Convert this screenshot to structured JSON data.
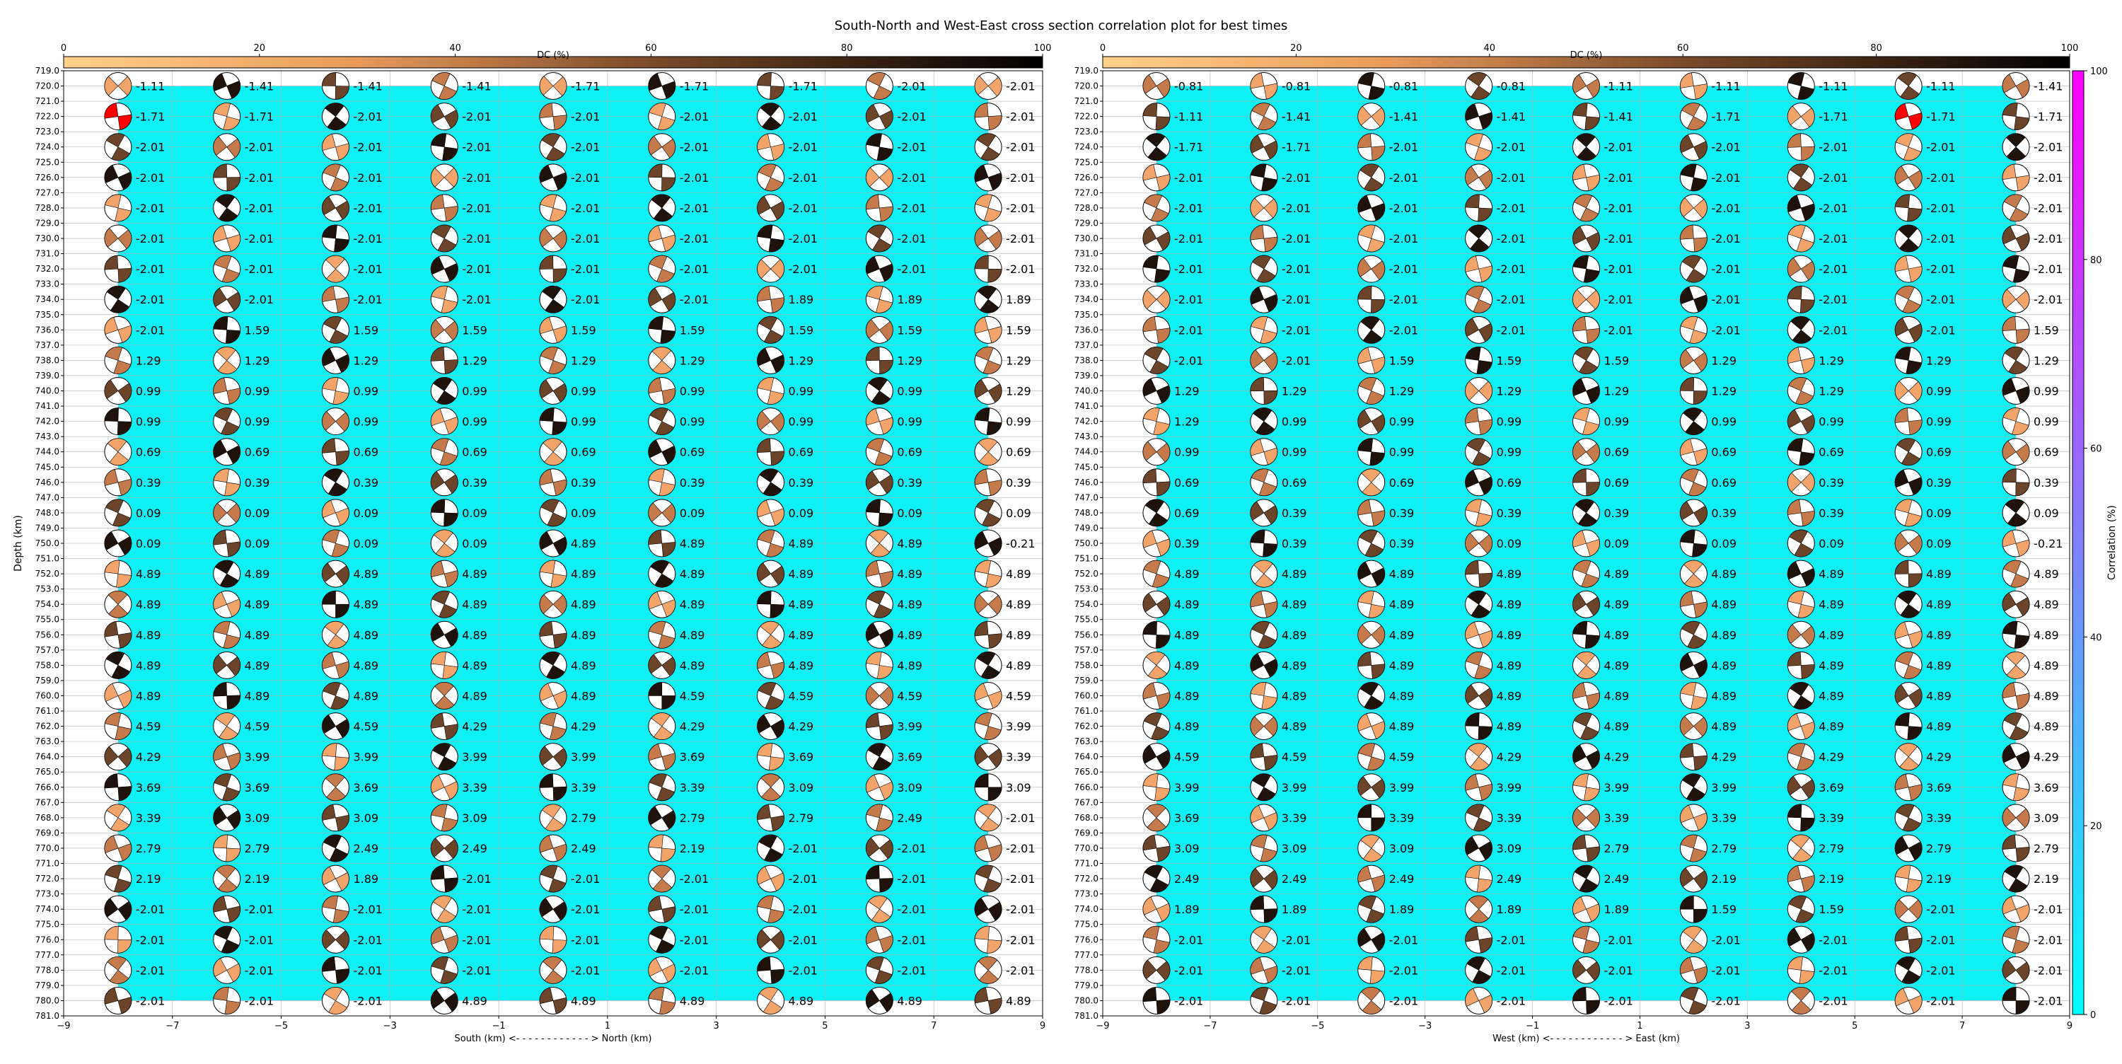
{
  "title": "South-North and West-East cross section correlation plot for best times",
  "colors": {
    "background_fill": "#0ef0f4",
    "dc_cmap": [
      "#ffffff",
      "#f5a865",
      "#c97b4a",
      "#7a4a2a",
      "#000000"
    ],
    "corr_cmap": [
      "#00ffff",
      "#8080ff",
      "#ff00ff"
    ],
    "highlight": "#ff0000",
    "grid": "#b0b0b0"
  },
  "dc_colorbar": {
    "label": "DC (%)",
    "ticks": [
      "0",
      "20",
      "40",
      "60",
      "80",
      "100"
    ]
  },
  "corr_colorbar": {
    "label": "Correlation (%)",
    "ticks": [
      "0",
      "20",
      "40",
      "60",
      "80",
      "100"
    ]
  },
  "y_label": "Depth (km)",
  "y_ticks": [
    "719.0",
    "720.0",
    "721.0",
    "722.0",
    "723.0",
    "724.0",
    "725.0",
    "726.0",
    "727.0",
    "728.0",
    "729.0",
    "730.0",
    "731.0",
    "732.0",
    "733.0",
    "734.0",
    "735.0",
    "736.0",
    "737.0",
    "738.0",
    "739.0",
    "740.0",
    "741.0",
    "742.0",
    "743.0",
    "744.0",
    "745.0",
    "746.0",
    "747.0",
    "748.0",
    "749.0",
    "750.0",
    "751.0",
    "752.0",
    "753.0",
    "754.0",
    "755.0",
    "756.0",
    "757.0",
    "758.0",
    "759.0",
    "760.0",
    "761.0",
    "762.0",
    "763.0",
    "764.0",
    "765.0",
    "766.0",
    "767.0",
    "768.0",
    "769.0",
    "770.0",
    "771.0",
    "772.0",
    "773.0",
    "774.0",
    "775.0",
    "776.0",
    "777.0",
    "778.0",
    "779.0",
    "780.0",
    "781.0"
  ],
  "chart_data": [
    {
      "type": "heatmap",
      "xlabel": "South (km) <- - - - - - - - - - - - > North (km)",
      "ylabel": "Depth (km)",
      "xlim": [
        -9,
        9
      ],
      "ylim": [
        781,
        719
      ],
      "x_ticks": [
        "−9",
        "−7",
        "−5",
        "−3",
        "−1",
        "1",
        "3",
        "5",
        "7",
        "9"
      ],
      "x": [
        -8,
        -6,
        -4,
        -2,
        0,
        2,
        4,
        6,
        8
      ],
      "depths": [
        720,
        722,
        724,
        726,
        728,
        730,
        732,
        734,
        736,
        738,
        740,
        742,
        744,
        746,
        748,
        750,
        752,
        754,
        756,
        758,
        760,
        762,
        764,
        766,
        768,
        770,
        772,
        774,
        776,
        778,
        780
      ],
      "labels": [
        [
          "-1.11",
          "-1.41",
          "-1.41",
          "-1.41",
          "-1.71",
          "-1.71",
          "-1.71",
          "-2.01",
          "-2.01"
        ],
        [
          "-1.71",
          "-1.71",
          "-2.01",
          "-2.01",
          "-2.01",
          "-2.01",
          "-2.01",
          "-2.01",
          "-2.01"
        ],
        [
          "-2.01",
          "-2.01",
          "-2.01",
          "-2.01",
          "-2.01",
          "-2.01",
          "-2.01",
          "-2.01",
          "-2.01"
        ],
        [
          "-2.01",
          "-2.01",
          "-2.01",
          "-2.01",
          "-2.01",
          "-2.01",
          "-2.01",
          "-2.01",
          "-2.01"
        ],
        [
          "-2.01",
          "-2.01",
          "-2.01",
          "-2.01",
          "-2.01",
          "-2.01",
          "-2.01",
          "-2.01",
          "-2.01"
        ],
        [
          "-2.01",
          "-2.01",
          "-2.01",
          "-2.01",
          "-2.01",
          "-2.01",
          "-2.01",
          "-2.01",
          "-2.01"
        ],
        [
          "-2.01",
          "-2.01",
          "-2.01",
          "-2.01",
          "-2.01",
          "-2.01",
          "-2.01",
          "-2.01",
          "-2.01"
        ],
        [
          "-2.01",
          "-2.01",
          "-2.01",
          "-2.01",
          "-2.01",
          "-2.01",
          "1.89",
          "1.89",
          "1.89"
        ],
        [
          "-2.01",
          "1.59",
          "1.59",
          "1.59",
          "1.59",
          "1.59",
          "1.59",
          "1.59",
          "1.59"
        ],
        [
          "1.29",
          "1.29",
          "1.29",
          "1.29",
          "1.29",
          "1.29",
          "1.29",
          "1.29",
          "1.29"
        ],
        [
          "0.99",
          "0.99",
          "0.99",
          "0.99",
          "0.99",
          "0.99",
          "0.99",
          "0.99",
          "1.29"
        ],
        [
          "0.99",
          "0.99",
          "0.99",
          "0.99",
          "0.99",
          "0.99",
          "0.99",
          "0.99",
          "0.99"
        ],
        [
          "0.69",
          "0.69",
          "0.69",
          "0.69",
          "0.69",
          "0.69",
          "0.69",
          "0.69",
          "0.69"
        ],
        [
          "0.39",
          "0.39",
          "0.39",
          "0.39",
          "0.39",
          "0.39",
          "0.39",
          "0.39",
          "0.39"
        ],
        [
          "0.09",
          "0.09",
          "0.09",
          "0.09",
          "0.09",
          "0.09",
          "0.09",
          "0.09",
          "0.09"
        ],
        [
          "0.09",
          "0.09",
          "0.09",
          "0.09",
          "4.89",
          "4.89",
          "4.89",
          "4.89",
          "-0.21"
        ],
        [
          "4.89",
          "4.89",
          "4.89",
          "4.89",
          "4.89",
          "4.89",
          "4.89",
          "4.89",
          "4.89"
        ],
        [
          "4.89",
          "4.89",
          "4.89",
          "4.89",
          "4.89",
          "4.89",
          "4.89",
          "4.89",
          "4.89"
        ],
        [
          "4.89",
          "4.89",
          "4.89",
          "4.89",
          "4.89",
          "4.89",
          "4.89",
          "4.89",
          "4.89"
        ],
        [
          "4.89",
          "4.89",
          "4.89",
          "4.89",
          "4.89",
          "4.89",
          "4.89",
          "4.89",
          "4.89"
        ],
        [
          "4.89",
          "4.89",
          "4.89",
          "4.89",
          "4.89",
          "4.59",
          "4.59",
          "4.59",
          "4.59"
        ],
        [
          "4.59",
          "4.59",
          "4.59",
          "4.29",
          "4.29",
          "4.29",
          "4.29",
          "3.99",
          "3.99"
        ],
        [
          "4.29",
          "3.99",
          "3.99",
          "3.99",
          "3.99",
          "3.69",
          "3.69",
          "3.69",
          "3.39"
        ],
        [
          "3.69",
          "3.69",
          "3.69",
          "3.39",
          "3.39",
          "3.39",
          "3.09",
          "3.09",
          "3.09"
        ],
        [
          "3.39",
          "3.09",
          "3.09",
          "3.09",
          "2.79",
          "2.79",
          "2.79",
          "2.49",
          "-2.01"
        ],
        [
          "2.79",
          "2.79",
          "2.49",
          "2.49",
          "2.49",
          "2.19",
          "-2.01",
          "-2.01",
          "-2.01"
        ],
        [
          "2.19",
          "2.19",
          "1.89",
          "-2.01",
          "-2.01",
          "-2.01",
          "-2.01",
          "-2.01",
          "-2.01"
        ],
        [
          "-2.01",
          "-2.01",
          "-2.01",
          "-2.01",
          "-2.01",
          "-2.01",
          "-2.01",
          "-2.01",
          "-2.01"
        ],
        [
          "-2.01",
          "-2.01",
          "-2.01",
          "-2.01",
          "-2.01",
          "-2.01",
          "-2.01",
          "-2.01",
          "-2.01"
        ],
        [
          "-2.01",
          "-2.01",
          "-2.01",
          "-2.01",
          "-2.01",
          "-2.01",
          "-2.01",
          "-2.01",
          "-2.01"
        ],
        [
          "-2.01",
          "-2.01",
          "-2.01",
          "4.89",
          "4.89",
          "4.89",
          "4.89",
          "4.89",
          "4.89"
        ]
      ],
      "highlighted_cell": {
        "depth": 722,
        "x": -8
      }
    },
    {
      "type": "heatmap",
      "xlabel": "West (km) <- - - - - - - - - - - - > East (km)",
      "ylabel": "Depth (km)",
      "xlim": [
        -9,
        9
      ],
      "ylim": [
        781,
        719
      ],
      "x_ticks": [
        "−9",
        "−7",
        "−5",
        "−3",
        "−1",
        "1",
        "3",
        "5",
        "7",
        "9"
      ],
      "x": [
        -8,
        -6,
        -4,
        -2,
        0,
        2,
        4,
        6,
        8
      ],
      "depths": [
        720,
        722,
        724,
        726,
        728,
        730,
        732,
        734,
        736,
        738,
        740,
        742,
        744,
        746,
        748,
        750,
        752,
        754,
        756,
        758,
        760,
        762,
        764,
        766,
        768,
        770,
        772,
        774,
        776,
        778,
        780
      ],
      "labels": [
        [
          "-0.81",
          "-0.81",
          "-0.81",
          "-0.81",
          "-1.11",
          "-1.11",
          "-1.11",
          "-1.11",
          "-1.41"
        ],
        [
          "-1.11",
          "-1.41",
          "-1.41",
          "-1.41",
          "-1.41",
          "-1.71",
          "-1.71",
          "-1.71",
          "-1.71"
        ],
        [
          "-1.71",
          "-1.71",
          "-2.01",
          "-2.01",
          "-2.01",
          "-2.01",
          "-2.01",
          "-2.01",
          "-2.01"
        ],
        [
          "-2.01",
          "-2.01",
          "-2.01",
          "-2.01",
          "-2.01",
          "-2.01",
          "-2.01",
          "-2.01",
          "-2.01"
        ],
        [
          "-2.01",
          "-2.01",
          "-2.01",
          "-2.01",
          "-2.01",
          "-2.01",
          "-2.01",
          "-2.01",
          "-2.01"
        ],
        [
          "-2.01",
          "-2.01",
          "-2.01",
          "-2.01",
          "-2.01",
          "-2.01",
          "-2.01",
          "-2.01",
          "-2.01"
        ],
        [
          "-2.01",
          "-2.01",
          "-2.01",
          "-2.01",
          "-2.01",
          "-2.01",
          "-2.01",
          "-2.01",
          "-2.01"
        ],
        [
          "-2.01",
          "-2.01",
          "-2.01",
          "-2.01",
          "-2.01",
          "-2.01",
          "-2.01",
          "-2.01",
          "-2.01"
        ],
        [
          "-2.01",
          "-2.01",
          "-2.01",
          "-2.01",
          "-2.01",
          "-2.01",
          "-2.01",
          "-2.01",
          "1.59"
        ],
        [
          "-2.01",
          "-2.01",
          "1.59",
          "1.59",
          "1.59",
          "1.29",
          "1.29",
          "1.29",
          "1.29"
        ],
        [
          "1.29",
          "1.29",
          "1.29",
          "1.29",
          "1.29",
          "1.29",
          "1.29",
          "0.99",
          "0.99"
        ],
        [
          "1.29",
          "0.99",
          "0.99",
          "0.99",
          "0.99",
          "0.99",
          "0.99",
          "0.99",
          "0.99"
        ],
        [
          "0.99",
          "0.99",
          "0.99",
          "0.99",
          "0.69",
          "0.69",
          "0.69",
          "0.69",
          "0.69"
        ],
        [
          "0.69",
          "0.69",
          "0.69",
          "0.69",
          "0.69",
          "0.69",
          "0.39",
          "0.39",
          "0.39"
        ],
        [
          "0.69",
          "0.39",
          "0.39",
          "0.39",
          "0.39",
          "0.39",
          "0.39",
          "0.09",
          "0.09"
        ],
        [
          "0.39",
          "0.39",
          "0.39",
          "0.09",
          "0.09",
          "0.09",
          "0.09",
          "0.09",
          "-0.21"
        ],
        [
          "4.89",
          "4.89",
          "4.89",
          "4.89",
          "4.89",
          "4.89",
          "4.89",
          "4.89",
          "4.89"
        ],
        [
          "4.89",
          "4.89",
          "4.89",
          "4.89",
          "4.89",
          "4.89",
          "4.89",
          "4.89",
          "4.89"
        ],
        [
          "4.89",
          "4.89",
          "4.89",
          "4.89",
          "4.89",
          "4.89",
          "4.89",
          "4.89",
          "4.89"
        ],
        [
          "4.89",
          "4.89",
          "4.89",
          "4.89",
          "4.89",
          "4.89",
          "4.89",
          "4.89",
          "4.89"
        ],
        [
          "4.89",
          "4.89",
          "4.89",
          "4.89",
          "4.89",
          "4.89",
          "4.89",
          "4.89",
          "4.89"
        ],
        [
          "4.89",
          "4.89",
          "4.89",
          "4.89",
          "4.89",
          "4.89",
          "4.89",
          "4.89",
          "4.89"
        ],
        [
          "4.59",
          "4.59",
          "4.59",
          "4.29",
          "4.29",
          "4.29",
          "4.29",
          "4.29",
          "4.29"
        ],
        [
          "3.99",
          "3.99",
          "3.99",
          "3.99",
          "3.99",
          "3.99",
          "3.69",
          "3.69",
          "3.69"
        ],
        [
          "3.69",
          "3.39",
          "3.39",
          "3.39",
          "3.39",
          "3.39",
          "3.39",
          "3.39",
          "3.09"
        ],
        [
          "3.09",
          "3.09",
          "3.09",
          "3.09",
          "2.79",
          "2.79",
          "2.79",
          "2.79",
          "2.79"
        ],
        [
          "2.49",
          "2.49",
          "2.49",
          "2.49",
          "2.49",
          "2.19",
          "2.19",
          "2.19",
          "2.19"
        ],
        [
          "1.89",
          "1.89",
          "1.89",
          "1.89",
          "1.89",
          "1.59",
          "1.59",
          "-2.01",
          "-2.01"
        ],
        [
          "-2.01",
          "-2.01",
          "-2.01",
          "-2.01",
          "-2.01",
          "-2.01",
          "-2.01",
          "-2.01",
          "-2.01"
        ],
        [
          "-2.01",
          "-2.01",
          "-2.01",
          "-2.01",
          "-2.01",
          "-2.01",
          "-2.01",
          "-2.01",
          "-2.01"
        ],
        [
          "-2.01",
          "-2.01",
          "-2.01",
          "-2.01",
          "-2.01",
          "-2.01",
          "-2.01",
          "-2.01",
          "-2.01"
        ]
      ],
      "highlighted_cell": {
        "depth": 722,
        "x": 6
      }
    }
  ]
}
